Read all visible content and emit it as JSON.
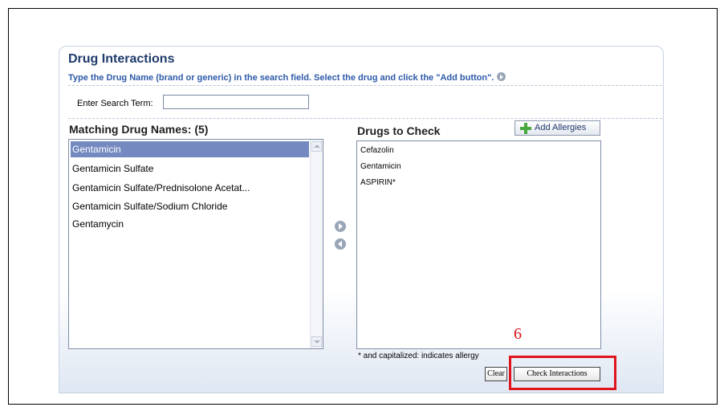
{
  "header": {
    "title": "Drug Interactions",
    "instructions": "Type the Drug Name (brand or generic) in the search field. Select the drug and click the \"Add button\"."
  },
  "search": {
    "label": "Enter Search Term:",
    "value": ""
  },
  "matching": {
    "heading": "Matching Drug Names: (5)",
    "items": [
      "Gentamicin",
      "Gentamicin Sulfate",
      "Gentamicin Sulfate/Prednisolone Acetat...",
      "Gentamicin Sulfate/Sodium Chloride",
      "Gentamycin"
    ],
    "selected_index": 0
  },
  "check": {
    "heading": "Drugs to Check",
    "add_allergies_label": "Add Allergies",
    "items": [
      "Cefazolin",
      "Gentamicin",
      "ASPIRIN*"
    ],
    "note": "* and capitalized: indicates allergy"
  },
  "buttons": {
    "clear_label": "Clear",
    "check_label": "Check Interactions"
  },
  "annotation": {
    "number": "6",
    "color": "#e0141c"
  },
  "colors": {
    "title": "#1f3a6b",
    "instructions": "#2d5aa8",
    "selection": "#7389bf"
  }
}
